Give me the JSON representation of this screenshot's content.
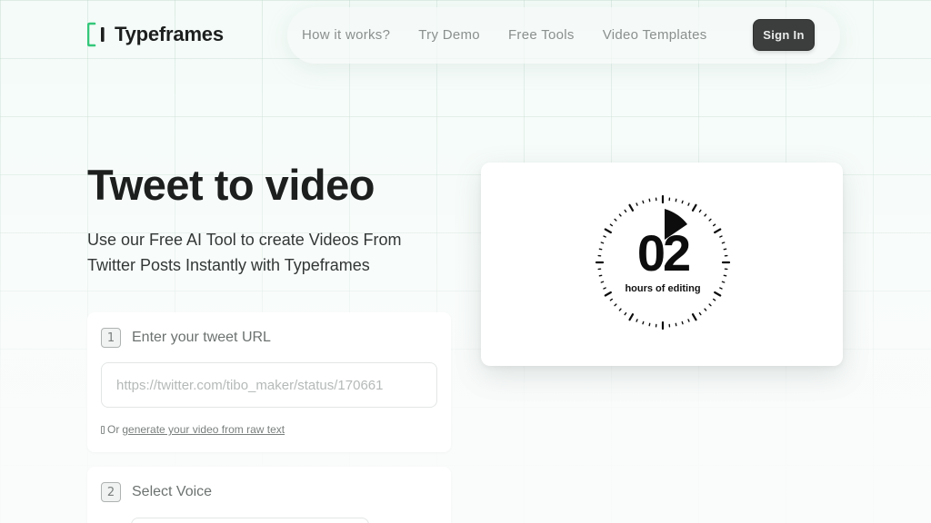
{
  "brand": {
    "name": "Typeframes",
    "accent": "#34c77b"
  },
  "nav": {
    "items": [
      {
        "label": "How it works?"
      },
      {
        "label": "Try Demo"
      },
      {
        "label": "Free Tools"
      },
      {
        "label": "Video Templates"
      }
    ],
    "signin_label": "Sign In"
  },
  "hero": {
    "title": "Tweet to video",
    "subtitle": "Use our Free AI Tool to create Videos From Twitter Posts Instantly with Typeframes"
  },
  "step1": {
    "number": "1",
    "label": "Enter your tweet URL",
    "placeholder": "https://twitter.com/tibo_maker/status/170661",
    "alt_prefix": "Or",
    "alt_link": "generate your video from raw text"
  },
  "step2": {
    "number": "2",
    "label": "Select Voice"
  },
  "preview": {
    "number": "02",
    "caption": "hours of editing"
  }
}
